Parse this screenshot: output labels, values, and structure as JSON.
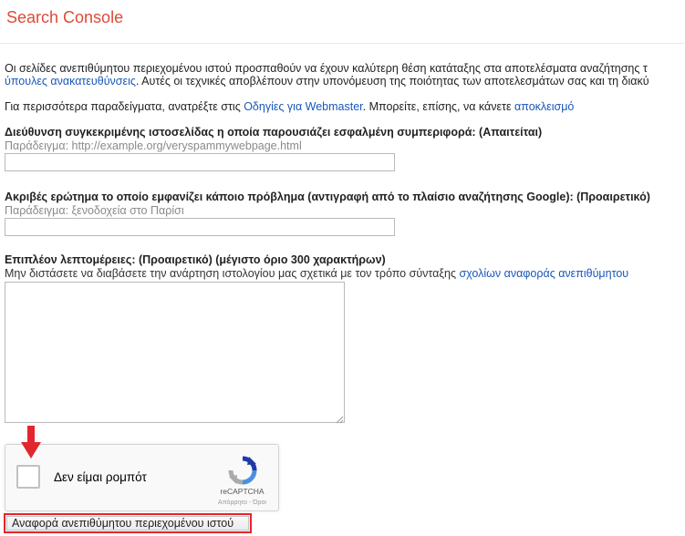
{
  "header": {
    "brand": "Search Console"
  },
  "intro": {
    "line1": "Οι σελίδες ανεπιθύμητου περιεχομένου ιστού προσπαθούν να έχουν καλύτερη θέση κατάταξης στα αποτελέσματα αναζήτησης τ",
    "line2_link": "ύπουλες ανακατευθύνσεις",
    "line2_text": ". Αυτές οι τεχνικές αποβλέπουν στην υπονόμευση της ποιότητας των αποτελεσμάτων σας και τη διακύ",
    "more_pre": "Για περισσότερα παραδείγματα, ανατρέξτε στις ",
    "more_link1": "Οδηγίες για Webmaster",
    "more_mid": ". Μπορείτε, επίσης, να κάνετε ",
    "more_link2": "αποκλεισμό"
  },
  "form": {
    "url_label": "Διεύθυνση συγκεκριμένης ιστοσελίδας η οποία παρουσιάζει εσφαλμένη συμπεριφορά: (Απαιτείται)",
    "url_hint": "Παράδειγμα: http://example.org/veryspammywebpage.html",
    "url_value": "",
    "query_label": "Ακριβές ερώτημα το οποίο εμφανίζει κάποιο πρόβλημα (αντιγραφή από το πλαίσιο αναζήτησης Google): (Προαιρετικό)",
    "query_hint": "Παράδειγμα: ξενοδοχεία στο Παρίσι",
    "query_value": "",
    "details_label": "Επιπλέον λεπτομέρειες: (Προαιρετικό) (μέγιστο όριο 300 χαρακτήρων)",
    "details_desc": "Μην διστάσετε να διαβάσετε την ανάρτηση ιστολογίου μας σχετικά με τον τρόπο σύνταξης ",
    "details_link": "σχολίων αναφοράς ανεπιθύμητου",
    "details_value": ""
  },
  "captcha": {
    "checkbox_label": "Δεν είμαι ρομπότ",
    "brand": "reCAPTCHA",
    "terms": "Απόρρητο - Όροι"
  },
  "submit": {
    "label": "Αναφορά ανεπιθύμητου περιεχομένου ιστού"
  },
  "colors": {
    "brand": "#dd4b39",
    "link": "#1a57b8",
    "highlight": "#e3262e"
  }
}
